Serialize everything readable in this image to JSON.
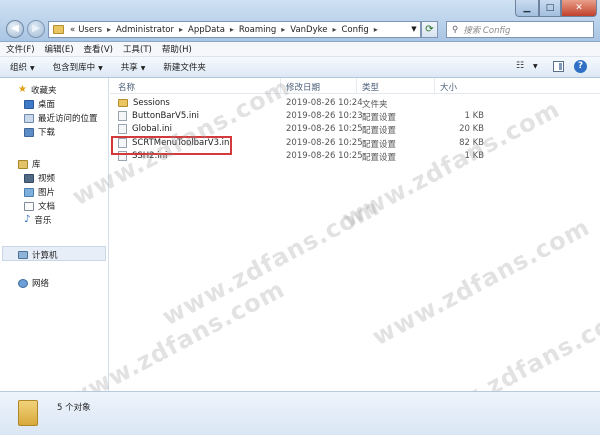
{
  "address": {
    "prefix": "«",
    "crumbs": [
      "Users",
      "Administrator",
      "AppData",
      "Roaming",
      "VanDyke",
      "Config"
    ]
  },
  "search": {
    "placeholder": "搜索 Config"
  },
  "menu": [
    "文件(F)",
    "编辑(E)",
    "查看(V)",
    "工具(T)",
    "帮助(H)"
  ],
  "toolbar": {
    "organize": "组织",
    "include_library": "包含到库中",
    "share": "共享",
    "new_folder": "新建文件夹"
  },
  "nav": {
    "favorites": "收藏夹",
    "desktop": "桌面",
    "recent": "最近访问的位置",
    "downloads": "下载",
    "libraries": "库",
    "videos": "视频",
    "pictures": "图片",
    "documents": "文档",
    "music": "音乐",
    "computer": "计算机",
    "network": "网络"
  },
  "columns": {
    "name": "名称",
    "date": "修改日期",
    "type": "类型",
    "size": "大小"
  },
  "files": [
    {
      "name": "Sessions",
      "date": "2019-08-26 10:24",
      "type": "文件夹",
      "size": ""
    },
    {
      "name": "ButtonBarV5.ini",
      "date": "2019-08-26 10:23",
      "type": "配置设置",
      "size": "1 KB"
    },
    {
      "name": "Global.ini",
      "date": "2019-08-26 10:25",
      "type": "配置设置",
      "size": "20 KB"
    },
    {
      "name": "SCRTMenuToolbarV3.ini",
      "date": "2019-08-26 10:25",
      "type": "配置设置",
      "size": "82 KB"
    },
    {
      "name": "SSH2.ini",
      "date": "2019-08-26 10:25",
      "type": "配置设置",
      "size": "1 KB"
    }
  ],
  "watermark": "www.zdfans.com",
  "status": {
    "count": "5 个对象"
  },
  "colors": {
    "highlight_border": "#d43a3a"
  }
}
